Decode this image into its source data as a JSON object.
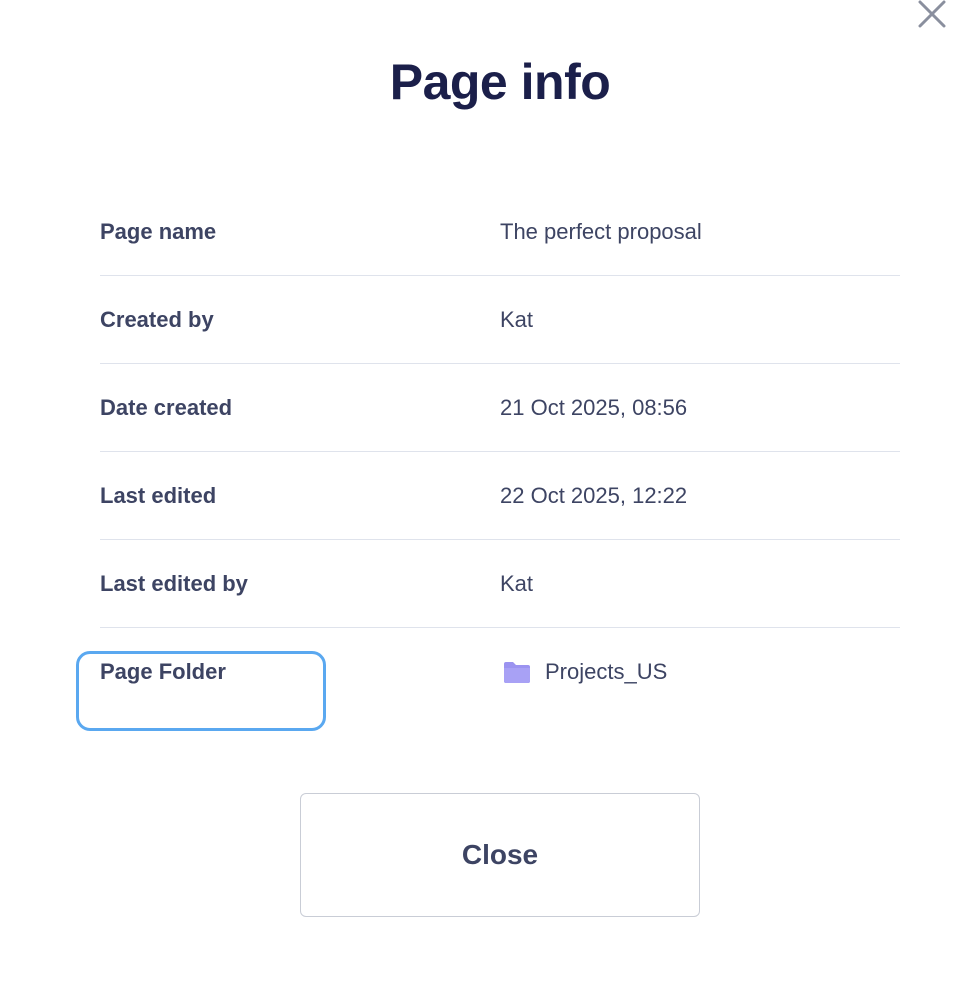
{
  "dialog": {
    "title": "Page info",
    "close_icon": "close-icon",
    "rows": [
      {
        "label": "Page name",
        "value": "The perfect proposal"
      },
      {
        "label": "Created by",
        "value": "Kat"
      },
      {
        "label": "Date created",
        "value": "21 Oct 2025, 08:56"
      },
      {
        "label": "Last edited",
        "value": "22 Oct 2025, 12:22"
      },
      {
        "label": "Last edited by",
        "value": "Kat"
      },
      {
        "label": "Page Folder",
        "value": "Projects_US",
        "icon": "folder-icon"
      }
    ],
    "close_button_label": "Close"
  },
  "colors": {
    "title": "#1b1f4a",
    "text": "#3d4463",
    "divider": "#dfe3ec",
    "focus_ring": "#5aa8f0",
    "folder": "#9b93f0"
  }
}
